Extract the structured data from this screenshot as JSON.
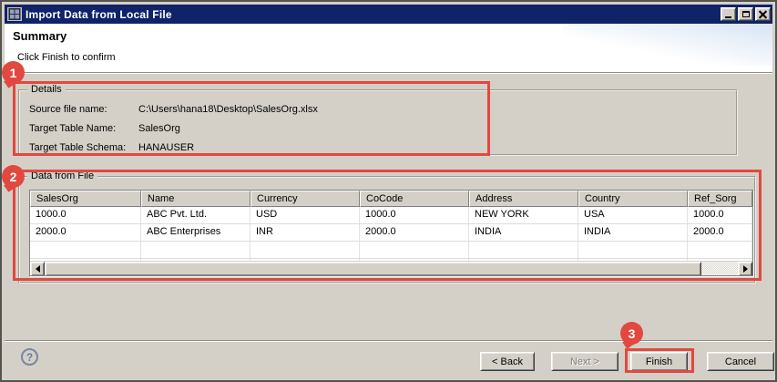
{
  "window": {
    "title": "Import Data from Local File"
  },
  "banner": {
    "title": "Summary",
    "subtitle": "Click Finish to confirm"
  },
  "details": {
    "group_label": "Details",
    "fields": [
      {
        "label": "Source file name:",
        "value": "C:\\Users\\hana18\\Desktop\\SalesOrg.xlsx"
      },
      {
        "label": "Target Table Name:",
        "value": "SalesOrg"
      },
      {
        "label": "Target Table Schema:",
        "value": "HANAUSER"
      }
    ]
  },
  "data_from_file": {
    "group_label": "Data from File",
    "columns": [
      "SalesOrg",
      "Name",
      "Currency",
      "CoCode",
      "Address",
      "Country",
      "Ref_Sorg"
    ],
    "rows": [
      [
        "1000.0",
        "ABC Pvt. Ltd.",
        "USD",
        "1000.0",
        "NEW YORK",
        "USA",
        "1000.0"
      ],
      [
        "2000.0",
        "ABC Enterprises",
        "INR",
        "2000.0",
        "INDIA",
        "INDIA",
        "2000.0"
      ]
    ],
    "empty_row_count": 2
  },
  "footer": {
    "help_label": "?",
    "back_label": "< Back",
    "next_label": "Next >",
    "finish_label": "Finish",
    "cancel_label": "Cancel"
  },
  "annotations": {
    "marker_1": "1",
    "marker_2": "2",
    "marker_3": "3",
    "highlight_color": "#e2483f"
  }
}
